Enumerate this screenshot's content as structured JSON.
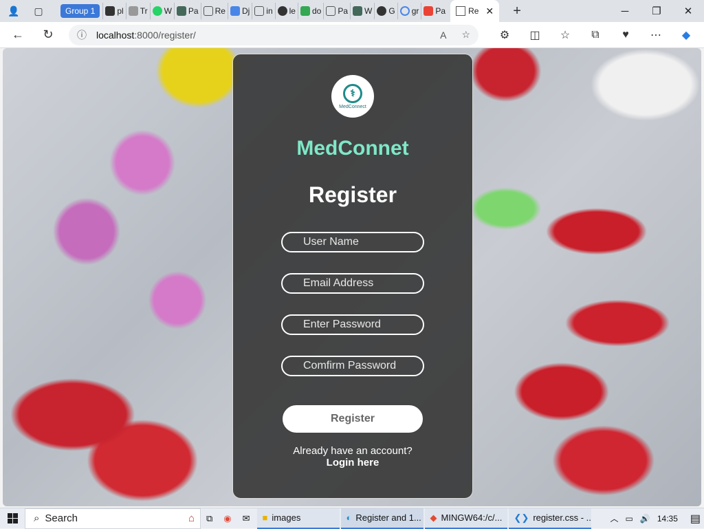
{
  "browser": {
    "group_label": "Group 1",
    "mini_tabs": [
      "pl",
      "Tr",
      "W",
      "Pa",
      "Re",
      "Dj",
      "in",
      "le",
      "do",
      "Pa",
      "W",
      "G",
      "gr",
      "Pa"
    ],
    "active_tab": "Re",
    "url_host": "localhost",
    "url_path": ":8000/register/"
  },
  "page": {
    "logo_text": "MedConnect",
    "brand": "MedConnet",
    "title": "Register",
    "fields": {
      "username_placeholder": "User Name",
      "email_placeholder": "Email Address",
      "password_placeholder": "Enter Password",
      "confirm_placeholder": "Comfirm Password"
    },
    "register_button": "Register",
    "already_text": "Already have an account?",
    "login_link": "Login here",
    "brand_color": "#7ee8c7"
  },
  "taskbar": {
    "search_label": "Search",
    "apps": [
      "images",
      "Register and 1...",
      "MINGW64:/c/...",
      "register.css - ..."
    ],
    "time": "14:35"
  }
}
